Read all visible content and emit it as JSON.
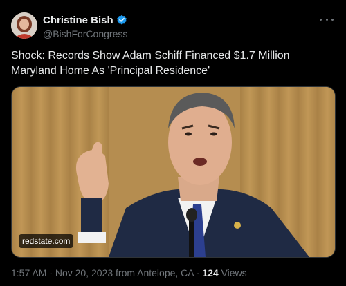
{
  "author": {
    "display_name": "Christine Bish",
    "handle": "@BishForCongress",
    "verified": true
  },
  "tweet": {
    "text": "Shock: Records Show Adam Schiff Financed $1.7 Million Maryland Home As 'Principal Residence'"
  },
  "media": {
    "source": "redstate.com"
  },
  "meta": {
    "time": "1:57 AM",
    "sep1": " · ",
    "date": "Nov 20, 2023",
    "from": " from Antelope, CA",
    "sep2": " · ",
    "views_count": "124",
    "views_label": " Views"
  },
  "colors": {
    "background": "#000000",
    "text": "#e7e9ea",
    "secondary": "#71767b",
    "verified_blue": "#1d9bf0"
  },
  "icons": [
    "verified-badge-icon",
    "more-options-icon"
  ]
}
